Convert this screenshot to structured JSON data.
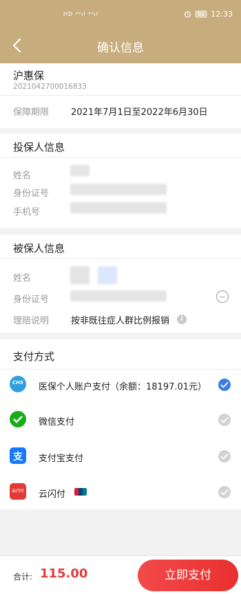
{
  "status_bar": {
    "network_text": "HD ⁴⁶ıl ⁴⁶ıl",
    "battery": "92",
    "time": "12:33"
  },
  "header": {
    "title": "确认信息"
  },
  "plan": {
    "name": "沪惠保",
    "number": "2021042700016833",
    "period_label": "保障期限",
    "period_value": "2021年7月1日至2022年6月30日"
  },
  "policyholder": {
    "title": "投保人信息",
    "name_label": "姓名",
    "id_label": "身份证号",
    "phone_label": "手机号"
  },
  "insured": {
    "title": "被保人信息",
    "name_label": "姓名",
    "id_label": "身份证号",
    "claim_label": "理赔说明",
    "claim_value": "按非既往症人群比例报销"
  },
  "payment": {
    "title": "支付方式",
    "methods": [
      {
        "label": "医保个人账户支付（余额：18197.01元）",
        "icon": "chs-icon",
        "icon_text": "CHS",
        "color": "#2f9fe0",
        "selected": true
      },
      {
        "label": "微信支付",
        "icon": "wechat-icon",
        "color": "#1aad19",
        "selected": false
      },
      {
        "label": "支付宝支付",
        "icon": "alipay-icon",
        "icon_text": "支",
        "color": "#1677ff",
        "selected": false
      },
      {
        "label": "云闪付",
        "icon": "unionpay-quickpass-icon",
        "icon_text": "云闪付",
        "color": "#e53935",
        "selected": false
      }
    ]
  },
  "footer": {
    "total_label": "合计:",
    "total_amount": "115.00",
    "pay_button": "立即支付"
  },
  "colors": {
    "header_bg": "#c7ad7e",
    "accent_red": "#e8302f",
    "check_blue": "#3b7de0"
  }
}
